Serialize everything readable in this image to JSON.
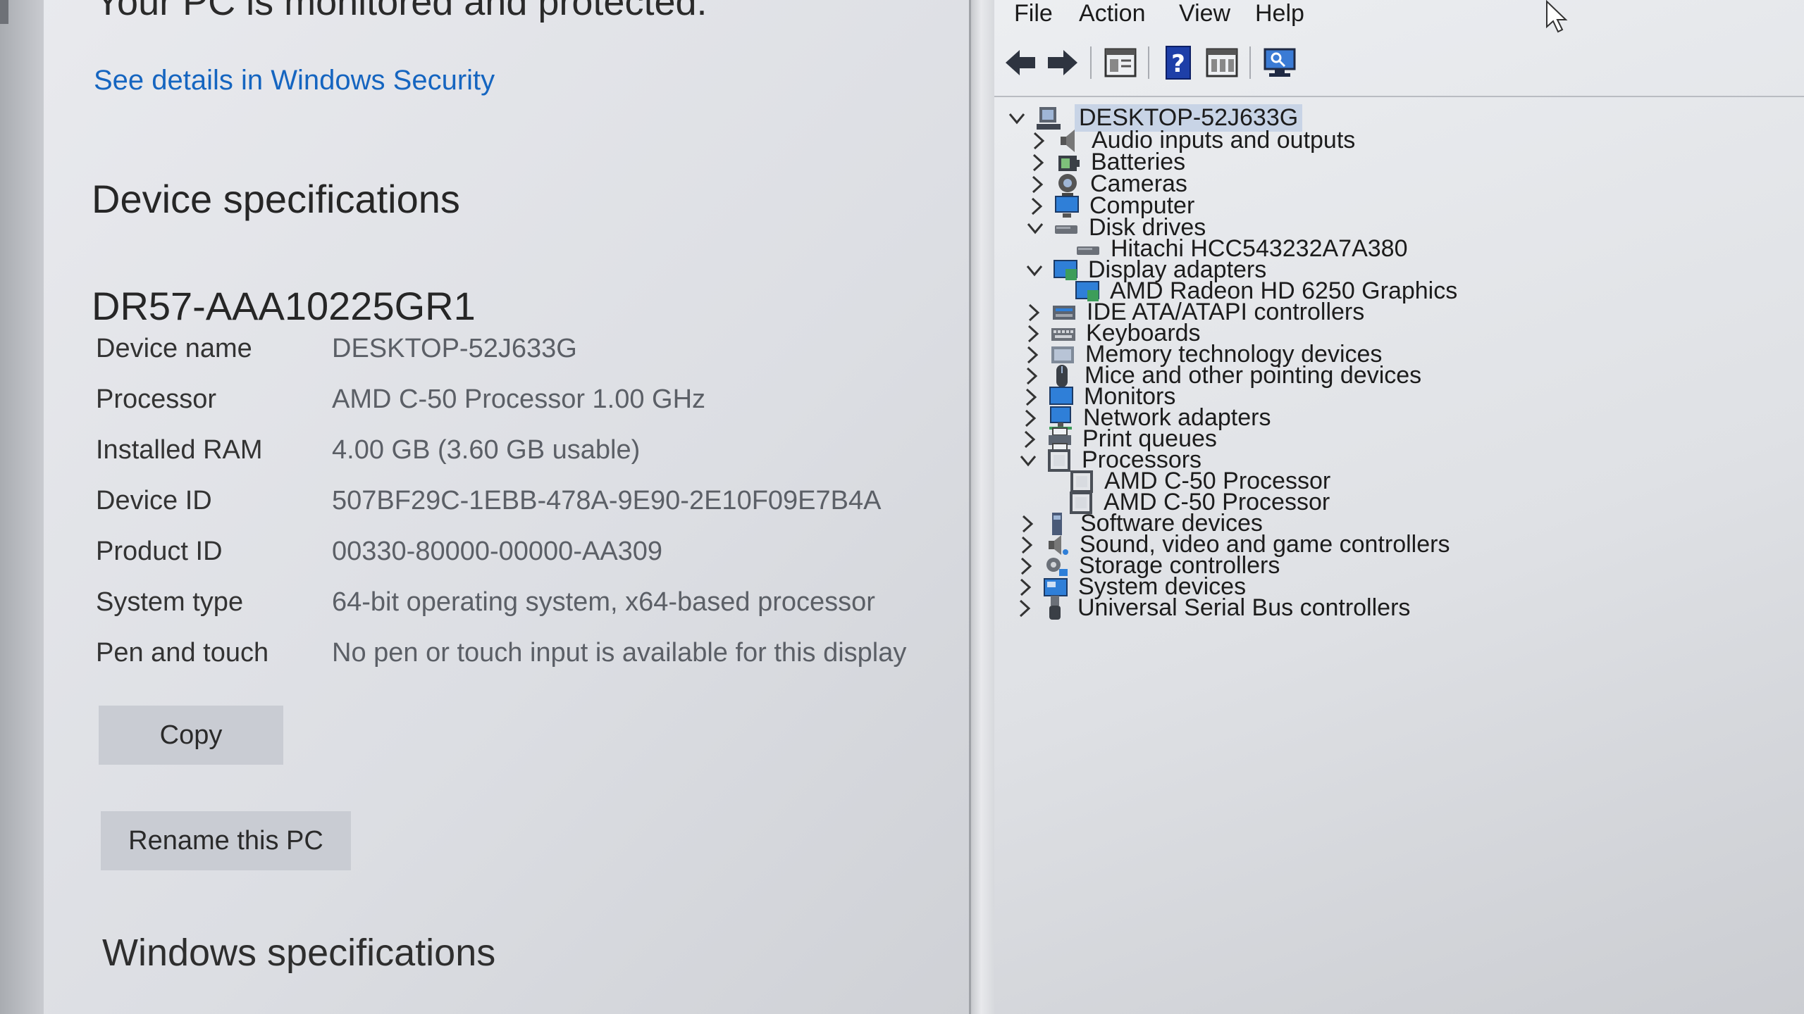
{
  "settings": {
    "protected_title": "Your PC is monitored and protected.",
    "security_link": "See details in Windows Security",
    "device_specs_title": "Device specifications",
    "device_model": "DR57-AAA10225GR1",
    "specs": [
      {
        "label": "Device name",
        "value": "DESKTOP-52J633G"
      },
      {
        "label": "Processor",
        "value": "AMD C-50 Processor   1.00 GHz"
      },
      {
        "label": "Installed RAM",
        "value": "4.00 GB (3.60 GB usable)"
      },
      {
        "label": "Device ID",
        "value": "507BF29C-1EBB-478A-9E90-2E10F09E7B4A"
      },
      {
        "label": "Product ID",
        "value": "00330-80000-00000-AA309"
      },
      {
        "label": "System type",
        "value": "64-bit operating system, x64-based processor"
      },
      {
        "label": "Pen and touch",
        "value": "No pen or touch input is available for this display"
      }
    ],
    "copy_label": "Copy",
    "rename_label": "Rename this PC",
    "windows_specs_title": "Windows specifications"
  },
  "device_manager": {
    "menu": [
      "File",
      "Action",
      "View",
      "Help"
    ],
    "toolbar_icons": [
      "back-arrow-icon",
      "forward-arrow-icon",
      "properties-pane-icon",
      "help-icon",
      "console-view-icon",
      "scan-hardware-icon"
    ],
    "root": "DESKTOP-52J633G",
    "tree": [
      {
        "label": "Audio inputs and outputs",
        "state": "collapsed",
        "icon": "speaker-icon"
      },
      {
        "label": "Batteries",
        "state": "collapsed",
        "icon": "battery-icon"
      },
      {
        "label": "Cameras",
        "state": "collapsed",
        "icon": "camera-icon"
      },
      {
        "label": "Computer",
        "state": "collapsed",
        "icon": "computer-icon"
      },
      {
        "label": "Disk drives",
        "state": "expanded",
        "icon": "disk-drive-icon"
      },
      {
        "label": "Hitachi HCC543232A7A380",
        "state": "child",
        "icon": "disk-drive-icon"
      },
      {
        "label": "Display adapters",
        "state": "expanded",
        "icon": "display-adapter-icon"
      },
      {
        "label": "AMD Radeon HD 6250 Graphics",
        "state": "child",
        "icon": "display-adapter-icon"
      },
      {
        "label": "IDE ATA/ATAPI controllers",
        "state": "collapsed",
        "icon": "ide-controller-icon"
      },
      {
        "label": "Keyboards",
        "state": "collapsed",
        "icon": "keyboard-icon"
      },
      {
        "label": "Memory technology devices",
        "state": "collapsed",
        "icon": "memory-icon"
      },
      {
        "label": "Mice and other pointing devices",
        "state": "collapsed",
        "icon": "mouse-icon"
      },
      {
        "label": "Monitors",
        "state": "collapsed",
        "icon": "monitor-icon"
      },
      {
        "label": "Network adapters",
        "state": "collapsed",
        "icon": "network-adapter-icon"
      },
      {
        "label": "Print queues",
        "state": "collapsed",
        "icon": "printer-icon"
      },
      {
        "label": "Processors",
        "state": "expanded",
        "icon": "processor-icon"
      },
      {
        "label": "AMD C-50 Processor",
        "state": "child",
        "icon": "processor-icon"
      },
      {
        "label": "AMD C-50 Processor",
        "state": "child",
        "icon": "processor-icon"
      },
      {
        "label": "Software devices",
        "state": "collapsed",
        "icon": "software-device-icon"
      },
      {
        "label": "Sound, video and game controllers",
        "state": "collapsed",
        "icon": "sound-controller-icon"
      },
      {
        "label": "Storage controllers",
        "state": "collapsed",
        "icon": "storage-controller-icon"
      },
      {
        "label": "System devices",
        "state": "collapsed",
        "icon": "system-devices-icon"
      },
      {
        "label": "Universal Serial Bus controllers",
        "state": "collapsed",
        "icon": "usb-icon"
      }
    ]
  },
  "colors": {
    "link": "#1565c0",
    "selection": "#c8d4e6"
  }
}
